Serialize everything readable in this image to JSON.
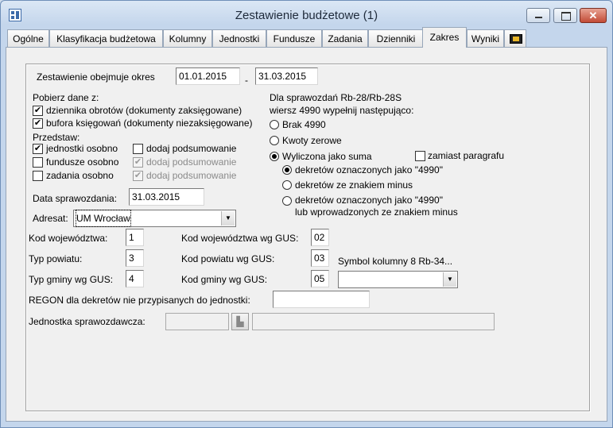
{
  "window": {
    "title": "Zestawienie budżetowe (1)",
    "icon": "app-window-icon",
    "controls": [
      "minimize-icon",
      "maximize-icon",
      "close-icon"
    ]
  },
  "tabs": [
    {
      "label": "Ogólne",
      "active": false
    },
    {
      "label": "Klasyfikacja budżetowa",
      "active": false
    },
    {
      "label": "Kolumny",
      "active": false
    },
    {
      "label": "Jednostki",
      "active": false
    },
    {
      "label": "Fundusze",
      "active": false
    },
    {
      "label": "Zadania",
      "active": false
    },
    {
      "label": "Dzienniki",
      "active": false
    },
    {
      "label": "Zakres",
      "active": true
    },
    {
      "label": "Wyniki",
      "active": false
    }
  ],
  "period": {
    "label": "Zestawienie obejmuje okres",
    "from": "01.01.2015",
    "separator": "-",
    "to": "31.03.2015"
  },
  "source": {
    "label": "Pobierz dane z:",
    "dziennik": {
      "label": "dziennika obrotów (dokumenty zaksięgowane)",
      "checked": true
    },
    "bufor": {
      "label": "bufora księgowań (dokumenty niezaksięgowane)",
      "checked": true
    }
  },
  "present": {
    "label": "Przedstaw:",
    "rows": [
      {
        "label": "jednostki osobno",
        "checked": true,
        "sum_label": "dodaj podsumowanie",
        "sum_checked": false,
        "sum_disabled": false
      },
      {
        "label": "fundusze osobno",
        "checked": false,
        "sum_label": "dodaj podsumowanie",
        "sum_checked": true,
        "sum_disabled": true
      },
      {
        "label": "zadania osobno",
        "checked": false,
        "sum_label": "dodaj podsumowanie",
        "sum_checked": true,
        "sum_disabled": true
      }
    ]
  },
  "rb": {
    "header1": "Dla sprawozdań Rb-28/Rb-28S",
    "header2": "wiersz 4990 wypełnij następująco:",
    "options": [
      {
        "label": "Brak 4990",
        "selected": false
      },
      {
        "label": "Kwoty zerowe",
        "selected": false
      },
      {
        "label": "Wyliczona jako suma",
        "selected": true
      }
    ],
    "instead": {
      "label": "zamiast paragrafu",
      "checked": false
    },
    "sub_options": [
      {
        "label": "dekretów oznaczonych jako \"4990\"",
        "selected": true
      },
      {
        "label": "dekretów ze znakiem minus",
        "selected": false
      },
      {
        "label": "dekretów oznaczonych jako \"4990\"",
        "label2": "lub wprowadzonych ze znakiem minus",
        "selected": false
      }
    ]
  },
  "report_date": {
    "label": "Data sprawozdania:",
    "value": "31.03.2015"
  },
  "adresat": {
    "label": "Adresat:",
    "value": "UM Wrocław"
  },
  "codes": {
    "woj": {
      "label": "Kod województwa:",
      "value": "1"
    },
    "powiat": {
      "label": "Typ powiatu:",
      "value": "3"
    },
    "gmina": {
      "label": "Typ gminy wg GUS:",
      "value": "4"
    },
    "woj_gus": {
      "label": "Kod województwa wg GUS:",
      "value": "02"
    },
    "powiat_gus": {
      "label": "Kod powiatu wg GUS:",
      "value": "03"
    },
    "gmina_gus": {
      "label": "Kod gminy wg GUS:",
      "value": "05"
    },
    "symbol": {
      "label": "Symbol kolumny 8  Rb-34...",
      "value": ""
    }
  },
  "regon": {
    "label": "REGON dla dekretów nie przypisanych do jednostki:",
    "value": ""
  },
  "reporting_unit": {
    "label": "Jednostka sprawozdawcza:",
    "code": "",
    "name": ""
  },
  "colors": {
    "accent": "#3c6aa8",
    "close": "#c24b36",
    "panel": "#f0f0f0"
  }
}
